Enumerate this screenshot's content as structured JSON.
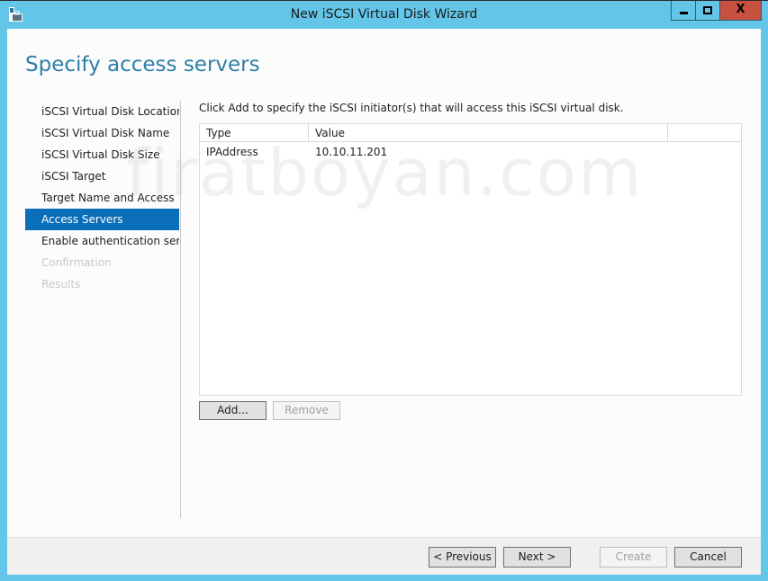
{
  "window": {
    "title": "New iSCSI Virtual Disk Wizard",
    "controls": {
      "minimize": "minimize",
      "maximize": "maximize",
      "close": "X"
    },
    "icon": "server-toolbox-icon"
  },
  "page": {
    "title": "Specify access servers",
    "instruction": "Click Add to specify the iSCSI initiator(s) that will access this iSCSI virtual disk."
  },
  "nav": {
    "items": [
      {
        "label": "iSCSI Virtual Disk Location",
        "state": "normal"
      },
      {
        "label": "iSCSI Virtual Disk Name",
        "state": "normal"
      },
      {
        "label": "iSCSI Virtual Disk Size",
        "state": "normal"
      },
      {
        "label": "iSCSI Target",
        "state": "normal"
      },
      {
        "label": "Target Name and Access",
        "state": "normal"
      },
      {
        "label": "Access Servers",
        "state": "active"
      },
      {
        "label": "Enable authentication ser...",
        "state": "normal"
      },
      {
        "label": "Confirmation",
        "state": "disabled"
      },
      {
        "label": "Results",
        "state": "disabled"
      }
    ]
  },
  "grid": {
    "columns": [
      "Type",
      "Value",
      ""
    ],
    "rows": [
      {
        "type": "IPAddress",
        "value": "10.10.11.201"
      }
    ]
  },
  "grid_buttons": {
    "add": "Add...",
    "remove": "Remove"
  },
  "footer": {
    "previous": "< Previous",
    "next": "Next >",
    "create": "Create",
    "cancel": "Cancel"
  },
  "watermark": "firatboyan.com",
  "colors": {
    "titlebar": "#63c6e8",
    "close_button": "#c7503f",
    "accent": "#0a6fb8",
    "title_text": "#2e7ea8"
  }
}
